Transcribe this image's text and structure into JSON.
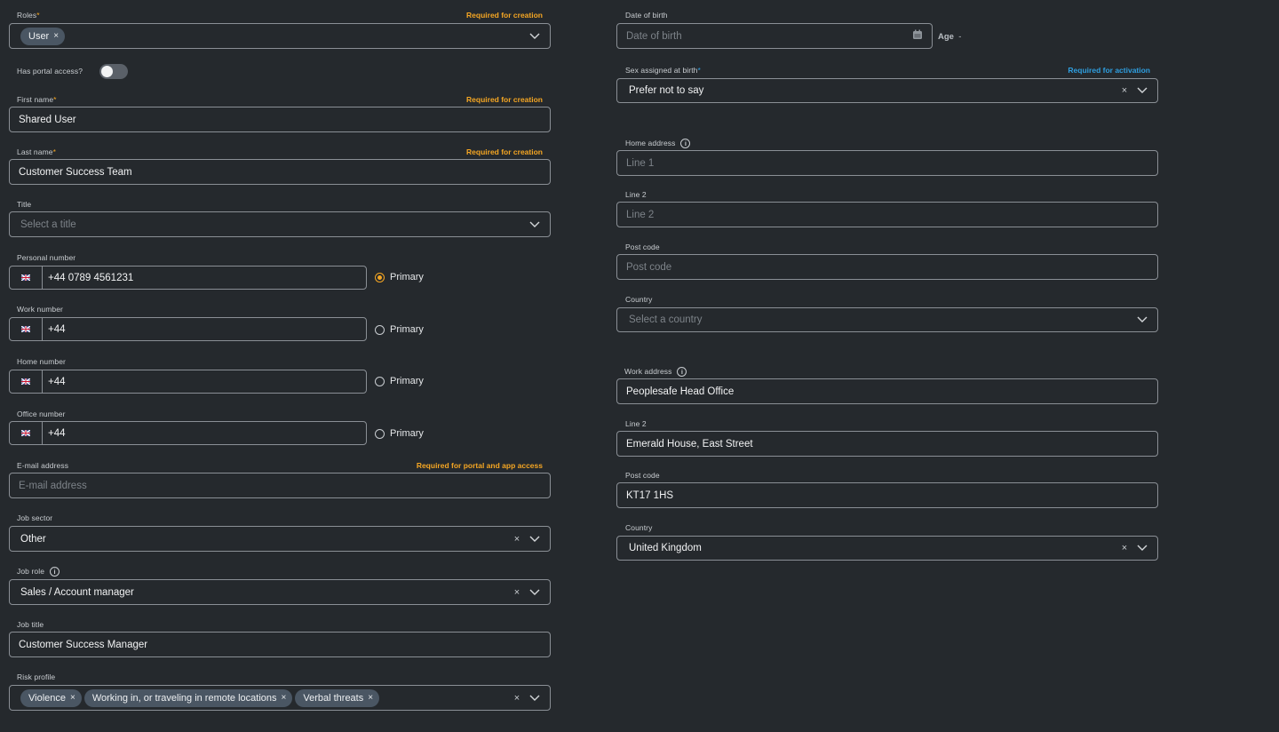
{
  "roles": {
    "label": "Roles",
    "required_note": "Required for creation",
    "chips": [
      "User"
    ]
  },
  "portal_access": {
    "label": "Has portal access?",
    "enabled": false
  },
  "first_name": {
    "label": "First name",
    "required_note": "Required for creation",
    "value": "Shared User"
  },
  "last_name": {
    "label": "Last name",
    "required_note": "Required for creation",
    "value": "Customer Success Team"
  },
  "title": {
    "label": "Title",
    "placeholder": "Select a title"
  },
  "personal_number": {
    "label": "Personal number",
    "value": "+44 0789 4561231",
    "primary_label": "Primary",
    "primary": true
  },
  "work_number": {
    "label": "Work number",
    "value": "+44",
    "primary_label": "Primary",
    "primary": false
  },
  "home_number": {
    "label": "Home number",
    "value": "+44",
    "primary_label": "Primary",
    "primary": false
  },
  "office_number": {
    "label": "Office number",
    "value": "+44",
    "primary_label": "Primary",
    "primary": false
  },
  "email": {
    "label": "E-mail address",
    "required_note": "Required for portal and app access",
    "placeholder": "E-mail address"
  },
  "job_sector": {
    "label": "Job sector",
    "value": "Other"
  },
  "job_role": {
    "label": "Job role",
    "value": "Sales / Account manager"
  },
  "job_title": {
    "label": "Job title",
    "value": "Customer Success Manager"
  },
  "risk_profile": {
    "label": "Risk profile",
    "chips": [
      "Violence",
      "Working in, or traveling in remote locations",
      "Verbal threats"
    ]
  },
  "dob": {
    "label": "Date of birth",
    "placeholder": "Date of birth",
    "age_label": "Age",
    "age_value": "-"
  },
  "sex": {
    "label": "Sex assigned at birth",
    "required_note": "Required for activation",
    "value": "Prefer not to say"
  },
  "home_address": {
    "label": "Home address",
    "line1_placeholder": "Line 1",
    "line2_label": "Line 2",
    "line2_placeholder": "Line 2",
    "postcode_label": "Post code",
    "postcode_placeholder": "Post code",
    "country_label": "Country",
    "country_placeholder": "Select a country"
  },
  "work_address": {
    "label": "Work address",
    "line1": "Peoplesafe Head Office",
    "line2_label": "Line 2",
    "line2": "Emerald House, East Street",
    "postcode_label": "Post code",
    "postcode": "KT17 1HS",
    "country_label": "Country",
    "country": "United Kingdom"
  },
  "icons": {
    "clear": "×",
    "chip_remove": "×",
    "info": "i"
  },
  "colors": {
    "background": "#25292d",
    "required_orange": "#f5a623",
    "required_blue": "#2f9fe0",
    "chip": "#4a5663",
    "border": "#8a8f95"
  }
}
